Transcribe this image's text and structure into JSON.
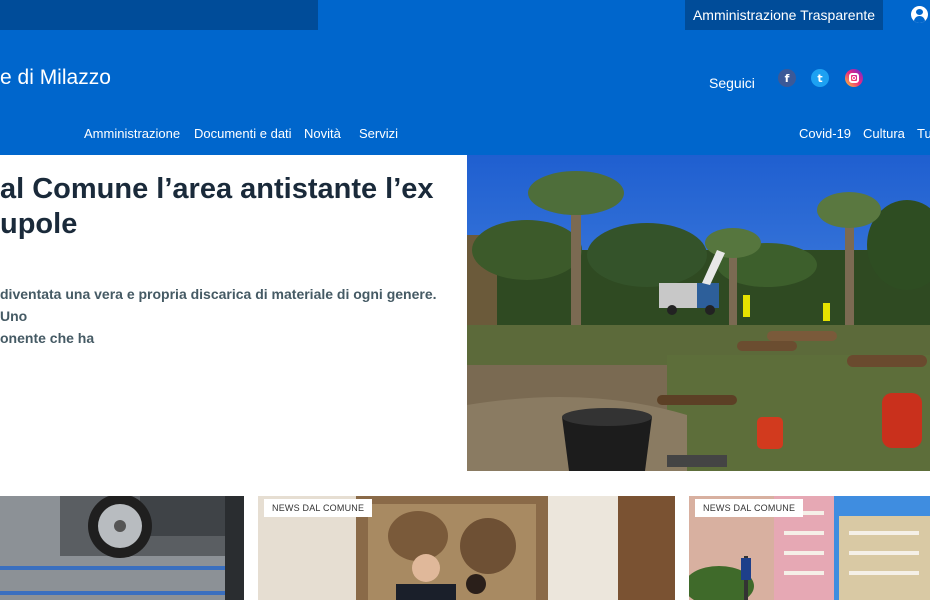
{
  "topbar": {
    "transparency_label": "Amministrazione Trasparente",
    "user_icon": "user-icon"
  },
  "header": {
    "site_title": "e di Milazzo",
    "follow_label": "Seguici",
    "social": [
      {
        "name": "facebook-icon",
        "glyph": "f"
      },
      {
        "name": "twitter-icon",
        "glyph": "t"
      },
      {
        "name": "instagram-icon",
        "glyph": ""
      }
    ]
  },
  "nav": {
    "main": [
      "Amministrazione",
      "Documenti e dati",
      "Novità",
      "Servizi"
    ],
    "secondary": [
      "Covid-19",
      "Cultura",
      "Tu"
    ]
  },
  "hero": {
    "title": "al Comune l’area antistante l’ex\nupole",
    "description": "diventata una vera e propria discarica di materiale di ogni genere. Uno\nonente che ha"
  },
  "cards": [
    {
      "badge": ""
    },
    {
      "badge": "NEWS DAL COMUNE"
    },
    {
      "badge": "NEWS DAL COMUNE"
    }
  ],
  "colors": {
    "brand_blue": "#0066cc",
    "dark_blue": "#004c99",
    "title_text": "#1a2a3a"
  }
}
